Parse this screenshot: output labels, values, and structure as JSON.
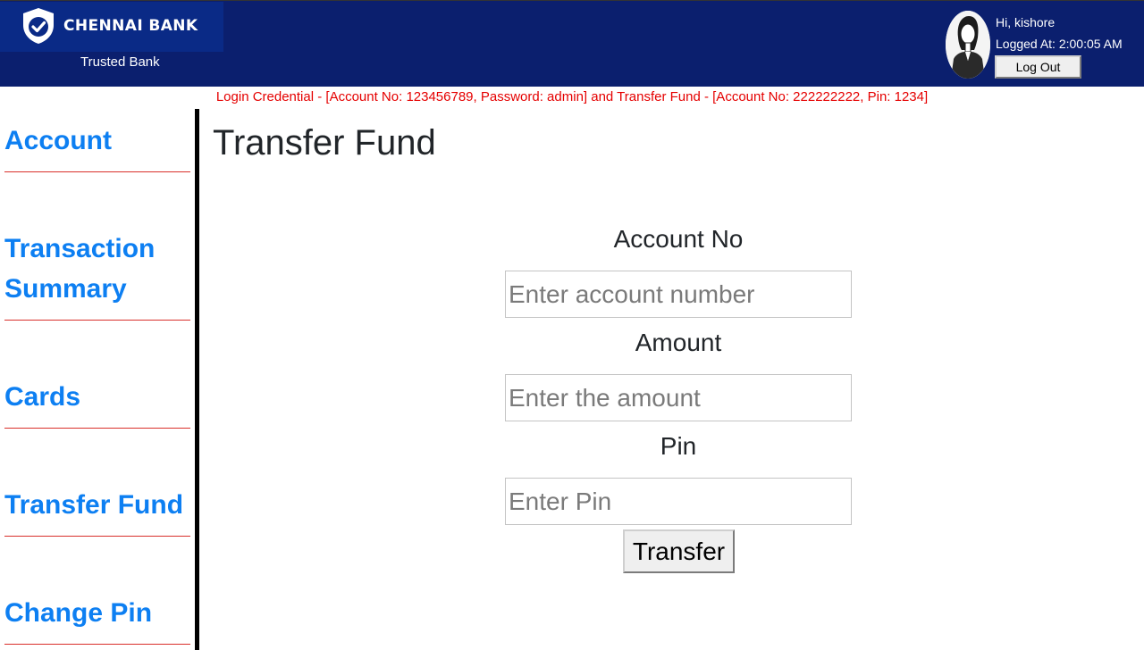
{
  "header": {
    "bank_name": "CHENNAI BANK",
    "tagline": "Trusted Bank",
    "logo_icon": "shield-check-icon",
    "brand_color": "#0b1f6e",
    "user": {
      "greeting": "Hi, kishore",
      "logged_at": "Logged At: 2:00:05 AM",
      "logout_label": "Log Out",
      "avatar_icon": "user-avatar-icon"
    }
  },
  "notice": "Login Credential - [Account No: 123456789, Password: admin] and Transfer Fund - [Account No: 222222222, Pin: 1234]",
  "sidebar": {
    "items": [
      {
        "label": "Account"
      },
      {
        "label": "Transaction Summary"
      },
      {
        "label": "Cards"
      },
      {
        "label": "Transfer Fund"
      },
      {
        "label": "Change Pin"
      }
    ]
  },
  "main": {
    "title": "Transfer Fund",
    "form": {
      "account_label": "Account No",
      "account_placeholder": "Enter account number",
      "amount_label": "Amount",
      "amount_placeholder": "Enter the amount",
      "pin_label": "Pin",
      "pin_placeholder": "Enter Pin",
      "submit_label": "Transfer"
    }
  }
}
